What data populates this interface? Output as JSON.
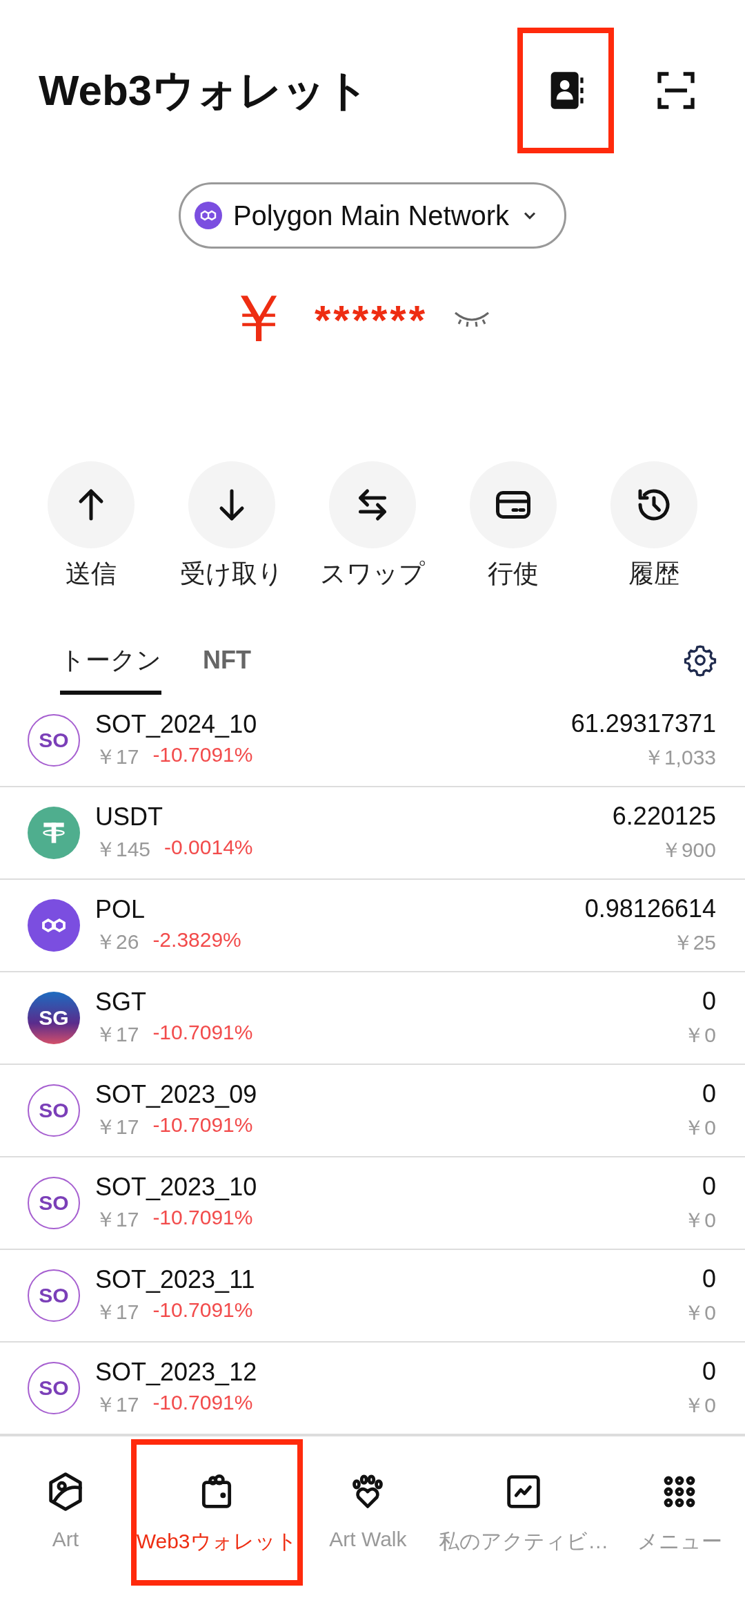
{
  "header": {
    "title": "Web3ウォレット",
    "actions": [
      {
        "kind": "contacts",
        "highlighted": true
      },
      {
        "kind": "scan",
        "highlighted": false
      }
    ]
  },
  "network": {
    "label": "Polygon Main Network"
  },
  "balance": {
    "currency": "￥",
    "value": "******",
    "hidden": true
  },
  "actions": [
    {
      "kind": "send",
      "label": "送信"
    },
    {
      "kind": "receive",
      "label": "受け取り"
    },
    {
      "kind": "swap",
      "label": "スワップ"
    },
    {
      "kind": "exercise",
      "label": "行使"
    },
    {
      "kind": "history",
      "label": "履歴"
    }
  ],
  "tabs": [
    {
      "label": "トークン",
      "selected": true
    },
    {
      "label": "NFT",
      "selected": false
    }
  ],
  "tokens": [
    {
      "name": "SOT_2024_10",
      "price": "￥17",
      "change": "-10.7091%",
      "amount": "61.29317371",
      "value": "￥1,033",
      "logo": {
        "kind": "so",
        "text": "SO"
      }
    },
    {
      "name": "USDT",
      "price": "￥145",
      "change": "-0.0014%",
      "amount": "6.220125",
      "value": "￥900",
      "logo": {
        "kind": "usdt"
      }
    },
    {
      "name": "POL",
      "price": "￥26",
      "change": "-2.3829%",
      "amount": "0.98126614",
      "value": "￥25",
      "logo": {
        "kind": "pol"
      }
    },
    {
      "name": "SGT",
      "price": "￥17",
      "change": "-10.7091%",
      "amount": "0",
      "value": "￥0",
      "logo": {
        "kind": "sg",
        "text": "SG"
      }
    },
    {
      "name": "SOT_2023_09",
      "price": "￥17",
      "change": "-10.7091%",
      "amount": "0",
      "value": "￥0",
      "logo": {
        "kind": "so",
        "text": "SO"
      }
    },
    {
      "name": "SOT_2023_10",
      "price": "￥17",
      "change": "-10.7091%",
      "amount": "0",
      "value": "￥0",
      "logo": {
        "kind": "so",
        "text": "SO"
      }
    },
    {
      "name": "SOT_2023_11",
      "price": "￥17",
      "change": "-10.7091%",
      "amount": "0",
      "value": "￥0",
      "logo": {
        "kind": "so",
        "text": "SO"
      }
    },
    {
      "name": "SOT_2023_12",
      "price": "￥17",
      "change": "-10.7091%",
      "amount": "0",
      "value": "￥0",
      "logo": {
        "kind": "so",
        "text": "SO"
      }
    }
  ],
  "nav": [
    {
      "kind": "art",
      "label": "Art",
      "selected": false,
      "highlighted": false
    },
    {
      "kind": "wallet",
      "label": "Web3ウォレット",
      "selected": true,
      "highlighted": true
    },
    {
      "kind": "walk",
      "label": "Art Walk",
      "selected": false,
      "highlighted": false
    },
    {
      "kind": "activity",
      "label": "私のアクティビ…",
      "selected": false,
      "highlighted": false
    },
    {
      "kind": "menu",
      "label": "メニュー",
      "selected": false,
      "highlighted": false
    }
  ]
}
